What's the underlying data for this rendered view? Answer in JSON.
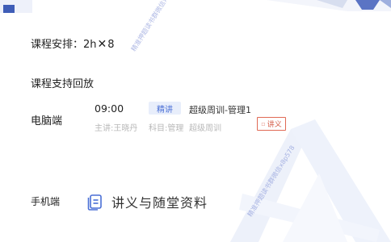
{
  "course": {
    "schedule_label": "课程安排：2h",
    "schedule_multiplier": "8",
    "replay_text": "课程支持回放"
  },
  "pc": {
    "label": "电脑端",
    "time": "09:00",
    "badge": "精讲",
    "course_title": "超级周训-管理1",
    "teacher": "主讲:王晓丹",
    "subject": "科目:管理",
    "subject_course": "超级周训",
    "handout_button": "讲义"
  },
  "mobile": {
    "label": "手机端",
    "materials_label": "讲义与随堂资料"
  },
  "watermarks": {
    "top": "精准押题读书群微信x8p578",
    "bottom": "精准押题读书群微信x8p578"
  },
  "colors": {
    "accent_blue": "#4a6fd6",
    "badge_bg": "#e8eefb",
    "handout_red": "#d45a45",
    "muted_text": "#b8b8b8"
  },
  "icons": {
    "multiply": "multiply-icon",
    "document": "document-icon",
    "handout": "handout-icon"
  }
}
